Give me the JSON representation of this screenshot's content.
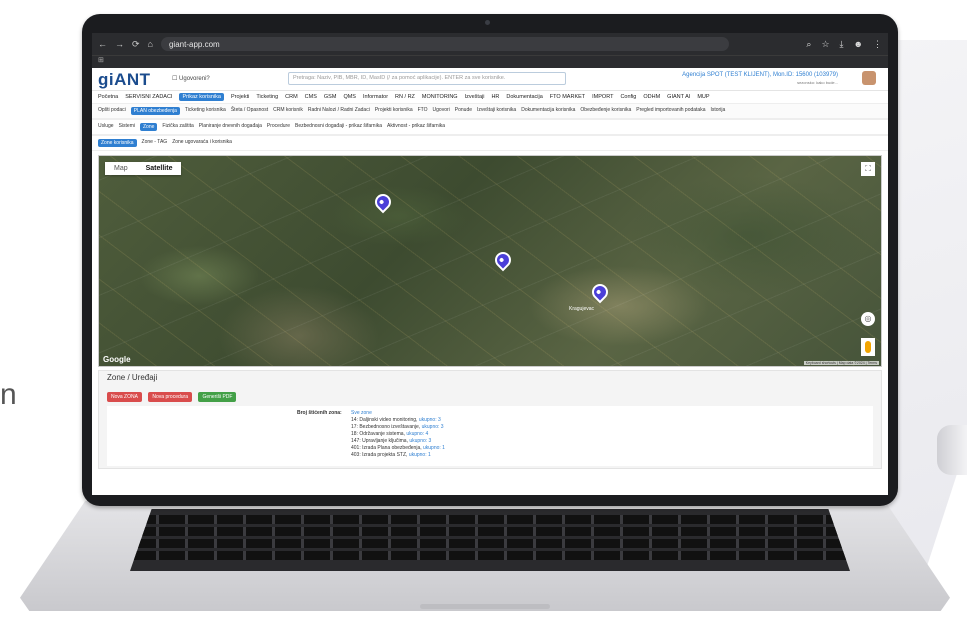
{
  "background": {
    "left_text": "n"
  },
  "browser": {
    "url": "giant-app.com",
    "nav": [
      "←",
      "→",
      "⟳",
      "⌂"
    ],
    "icons": [
      "zoom-icon",
      "star-icon",
      "download-icon",
      "profile-icon",
      "menu-icon"
    ],
    "bookmark_glyph": "⊞"
  },
  "app": {
    "logo_main": "gi",
    "logo_accent": "ANT",
    "ugovoreni_label": "Ugovoreni?",
    "search_placeholder": "Pretraga: Naziv, PIB, MBR, ID, MasID (/ za pomoć aplikacije). ENTER za sve korisnike.",
    "agency_line1": "Agencija SPOT (TEST KLIJENT), Mon.ID: 15600 (103979)",
    "agency_line2": "sezonsko: kako bude..."
  },
  "menu": [
    {
      "label": "Početna",
      "active": false
    },
    {
      "label": "SERVISNI ZADACI",
      "active": false
    },
    {
      "label": "Prikaz korisnika",
      "active": true
    },
    {
      "label": "Projekti",
      "active": false
    },
    {
      "label": "Ticketing",
      "active": false
    },
    {
      "label": "CRM",
      "active": false
    },
    {
      "label": "CMS",
      "active": false
    },
    {
      "label": "GSM",
      "active": false
    },
    {
      "label": "QMS",
      "active": false
    },
    {
      "label": "Informator",
      "active": false
    },
    {
      "label": "RN / RZ",
      "active": false
    },
    {
      "label": "MONITORING",
      "active": false
    },
    {
      "label": "Izveštaji",
      "active": false
    },
    {
      "label": "HR",
      "active": false
    },
    {
      "label": "Dokumentacija",
      "active": false
    },
    {
      "label": "FTO MARKET",
      "active": false
    },
    {
      "label": "IMPORT",
      "active": false
    },
    {
      "label": "Config",
      "active": false
    },
    {
      "label": "ODHM",
      "active": false
    },
    {
      "label": "GIANT AI",
      "active": false
    },
    {
      "label": "MUP",
      "active": false
    }
  ],
  "tabs1": [
    {
      "label": "Opšti podaci",
      "active": false
    },
    {
      "label": "PLAN obezbeđenja",
      "active": true
    },
    {
      "label": "Ticketing korisnika",
      "active": false
    },
    {
      "label": "Šteta / Opasnost",
      "active": false
    },
    {
      "label": "CRM korisnik",
      "active": false
    },
    {
      "label": "Radni Nalozi / Radni Zadaci",
      "active": false
    },
    {
      "label": "Projekti korisnika",
      "active": false
    },
    {
      "label": "FTO",
      "active": false
    },
    {
      "label": "Ugovori",
      "active": false
    },
    {
      "label": "Ponude",
      "active": false
    },
    {
      "label": "Izveštaji korisnika",
      "active": false
    },
    {
      "label": "Dokumentacija korisnika",
      "active": false
    },
    {
      "label": "Obezbeđenje korisnika",
      "active": false
    },
    {
      "label": "Pregled importovanih podataka",
      "active": false
    },
    {
      "label": "Istorija",
      "active": false
    }
  ],
  "tabs2": [
    {
      "label": "Usluge",
      "active": false
    },
    {
      "label": "Sistemi",
      "active": false
    },
    {
      "label": "Zone",
      "active": true
    },
    {
      "label": "Fizička zaštita",
      "active": false
    },
    {
      "label": "Planiranje dnevnih događaja",
      "active": false
    },
    {
      "label": "Procedure",
      "active": false
    },
    {
      "label": "Bezbednosni događaji - prikaz šifarnika",
      "active": false
    },
    {
      "label": "Aktivnost - prikaz šifarnika",
      "active": false
    }
  ],
  "tabs3": [
    {
      "label": "Zone korisnika",
      "active": true
    },
    {
      "label": "Zone - TAG",
      "active": false
    },
    {
      "label": "Zone ugovaraća i korisnika",
      "active": false
    }
  ],
  "map": {
    "type_buttons": [
      {
        "label": "Map",
        "selected": false
      },
      {
        "label": "Satellite",
        "selected": true
      }
    ],
    "google_label": "Google",
    "attribution": "Keyboard shortcuts | Map data ©2024 | Terms",
    "city_label": "Kragujevac",
    "fullscreen_glyph": "⛶",
    "compass_glyph": "◎"
  },
  "zones": {
    "title": "Zone / Uređaji",
    "buttons": [
      {
        "label": "Nova ZONA",
        "color": "#d94c4c"
      },
      {
        "label": "Nova procedura",
        "color": "#d94c4c"
      },
      {
        "label": "Generiši PDF",
        "color": "#43a047"
      }
    ],
    "count_label": "Broj štićenih zona:",
    "all_link": "Sve zone",
    "items": [
      {
        "text": "14: Daljinski video monitoring, ",
        "link": "ukupno: 3"
      },
      {
        "text": "17: Bezbednosno izveštavanje, ",
        "link": "ukupno: 3"
      },
      {
        "text": "18: Održavanje sistema, ",
        "link": "ukupno: 4"
      },
      {
        "text": "147: Upravljanje ključima, ",
        "link": "ukupno: 3"
      },
      {
        "text": "401: Izrada Plana obezbeđenja, ",
        "link": "ukupno: 1"
      },
      {
        "text": "403: Izrada projekta STZ, ",
        "link": "ukupno: 1"
      }
    ]
  }
}
